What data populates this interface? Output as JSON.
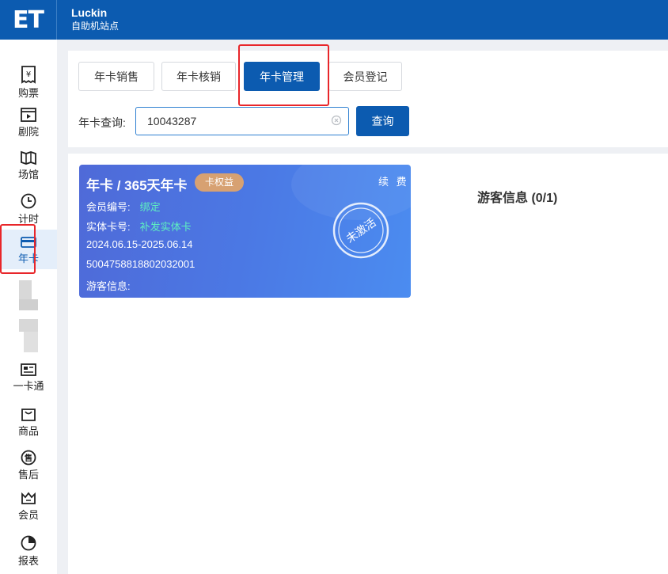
{
  "app": {
    "logo_text": "ET",
    "store_name": "Luckin",
    "store_subtitle": "自助机站点"
  },
  "sidebar": {
    "items": [
      {
        "label": "购票",
        "icon": "ticket-icon"
      },
      {
        "label": "剧院",
        "icon": "theater-icon"
      },
      {
        "label": "场馆",
        "icon": "venue-icon"
      },
      {
        "label": "计时",
        "icon": "clock-icon"
      },
      {
        "label": "年卡",
        "icon": "card-icon",
        "active": true
      },
      {
        "label": "一卡通",
        "icon": "id-card-icon"
      },
      {
        "label": "商品",
        "icon": "bag-icon"
      },
      {
        "label": "售后",
        "icon": "aftersale-icon"
      },
      {
        "label": "会员",
        "icon": "crown-icon"
      },
      {
        "label": "报表",
        "icon": "pie-chart-icon"
      }
    ]
  },
  "tabs": [
    {
      "label": "年卡销售"
    },
    {
      "label": "年卡核销"
    },
    {
      "label": "年卡管理",
      "active": true
    },
    {
      "label": "会员登记"
    }
  ],
  "query": {
    "label": "年卡查询:",
    "value": "10043287",
    "button": "查询"
  },
  "card": {
    "title": "年卡 / 365天年卡",
    "badge": "卡权益",
    "renew": "续 费",
    "member_no_label": "会员编号:",
    "member_no_value": "绑定",
    "physical_label": "实体卡号:",
    "physical_value": "补发实体卡",
    "validity": "2024.06.15-2025.06.14",
    "card_number": "5004758818802032001",
    "guest_label": "游客信息:",
    "stamp": "未激活"
  },
  "guest_panel": {
    "title": "游客信息 (0/1)"
  },
  "colors": {
    "brand": "#0c5bb0",
    "highlight": "#e8262a",
    "card_value": "#5ef0c0",
    "badge": "#d7a172"
  }
}
